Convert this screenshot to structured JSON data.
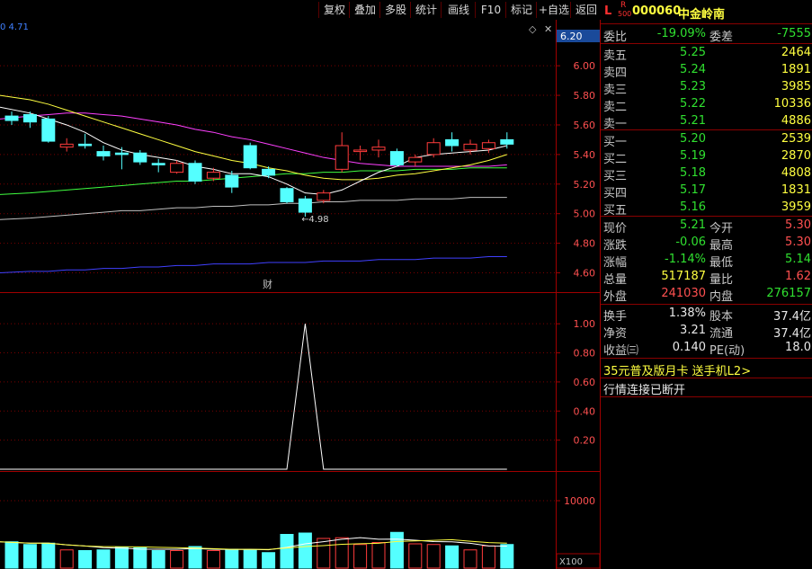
{
  "toolbar": {
    "buttons": [
      "复权",
      "叠加",
      "多股",
      "统计",
      "画线",
      "F10",
      "标记",
      "+自选",
      "返回"
    ]
  },
  "chart": {
    "ma_label": "0 4.71",
    "top_price_tag": "6.20",
    "price_axis": [
      "6.00",
      "5.80",
      "5.60",
      "5.40",
      "5.20",
      "5.00",
      "4.80",
      "4.60"
    ],
    "low_marker": "4.98",
    "fin_mark": "财",
    "indicator_axis": [
      "1.00",
      "0.80",
      "0.60",
      "0.40",
      "0.20"
    ],
    "volume_axis": [
      "10000"
    ],
    "volume_unit": "X100",
    "colors": {
      "up": "#ff3b3b",
      "down": "#54ffff",
      "ma5": "#ffffff",
      "ma10": "#ffff40",
      "ma20": "#ff40ff",
      "ma60": "#40ff40",
      "ma120": "#c0c0c0",
      "ma250": "#4040ff",
      "border": "#a00000"
    }
  },
  "chart_data": {
    "type": "candlestick",
    "candles": [
      {
        "o": 5.66,
        "h": 5.69,
        "l": 5.6,
        "c": 5.63
      },
      {
        "o": 5.67,
        "h": 5.69,
        "l": 5.58,
        "c": 5.62
      },
      {
        "o": 5.64,
        "h": 5.66,
        "l": 5.48,
        "c": 5.49
      },
      {
        "o": 5.45,
        "h": 5.51,
        "l": 5.42,
        "c": 5.47
      },
      {
        "o": 5.47,
        "h": 5.54,
        "l": 5.44,
        "c": 5.46
      },
      {
        "o": 5.42,
        "h": 5.46,
        "l": 5.36,
        "c": 5.39
      },
      {
        "o": 5.41,
        "h": 5.45,
        "l": 5.3,
        "c": 5.4
      },
      {
        "o": 5.41,
        "h": 5.43,
        "l": 5.33,
        "c": 5.35
      },
      {
        "o": 5.34,
        "h": 5.37,
        "l": 5.28,
        "c": 5.33
      },
      {
        "o": 5.28,
        "h": 5.36,
        "l": 5.27,
        "c": 5.34
      },
      {
        "o": 5.34,
        "h": 5.36,
        "l": 5.2,
        "c": 5.22
      },
      {
        "o": 5.24,
        "h": 5.31,
        "l": 5.22,
        "c": 5.28
      },
      {
        "o": 5.26,
        "h": 5.29,
        "l": 5.14,
        "c": 5.18
      },
      {
        "o": 5.46,
        "h": 5.48,
        "l": 5.3,
        "c": 5.31
      },
      {
        "o": 5.3,
        "h": 5.32,
        "l": 5.24,
        "c": 5.26
      },
      {
        "o": 5.17,
        "h": 5.18,
        "l": 5.07,
        "c": 5.08
      },
      {
        "o": 5.1,
        "h": 5.12,
        "l": 4.98,
        "c": 5.01
      },
      {
        "o": 5.09,
        "h": 5.16,
        "l": 5.07,
        "c": 5.14
      },
      {
        "o": 5.3,
        "h": 5.55,
        "l": 5.28,
        "c": 5.46
      },
      {
        "o": 5.42,
        "h": 5.46,
        "l": 5.36,
        "c": 5.43
      },
      {
        "o": 5.43,
        "h": 5.5,
        "l": 5.38,
        "c": 5.45
      },
      {
        "o": 5.42,
        "h": 5.44,
        "l": 5.32,
        "c": 5.33
      },
      {
        "o": 5.35,
        "h": 5.4,
        "l": 5.32,
        "c": 5.38
      },
      {
        "o": 5.4,
        "h": 5.51,
        "l": 5.38,
        "c": 5.48
      },
      {
        "o": 5.5,
        "h": 5.55,
        "l": 5.42,
        "c": 5.46
      },
      {
        "o": 5.43,
        "h": 5.5,
        "l": 5.4,
        "c": 5.47
      },
      {
        "o": 5.44,
        "h": 5.5,
        "l": 5.41,
        "c": 5.48
      },
      {
        "o": 5.5,
        "h": 5.55,
        "l": 5.44,
        "c": 5.47
      }
    ],
    "ma5": [
      5.72,
      5.68,
      5.64,
      5.6,
      5.55,
      5.48,
      5.43,
      5.4,
      5.38,
      5.36,
      5.32,
      5.3,
      5.27,
      5.27,
      5.25,
      5.2,
      5.14,
      5.13,
      5.16,
      5.22,
      5.28,
      5.32,
      5.38,
      5.4,
      5.41,
      5.42,
      5.43,
      5.46
    ],
    "ma10": [
      5.8,
      5.77,
      5.74,
      5.7,
      5.66,
      5.62,
      5.58,
      5.54,
      5.5,
      5.46,
      5.42,
      5.39,
      5.36,
      5.34,
      5.31,
      5.29,
      5.26,
      5.24,
      5.23,
      5.23,
      5.24,
      5.26,
      5.27,
      5.29,
      5.31,
      5.33,
      5.36,
      5.4
    ],
    "ma20": [
      5.64,
      5.66,
      5.67,
      5.68,
      5.68,
      5.67,
      5.66,
      5.64,
      5.62,
      5.6,
      5.57,
      5.55,
      5.52,
      5.5,
      5.47,
      5.44,
      5.41,
      5.38,
      5.36,
      5.34,
      5.33,
      5.32,
      5.32,
      5.32,
      5.32,
      5.32,
      5.32,
      5.33
    ],
    "ma60": [
      5.13,
      5.14,
      5.15,
      5.16,
      5.17,
      5.18,
      5.19,
      5.2,
      5.21,
      5.22,
      5.22,
      5.23,
      5.24,
      5.25,
      5.26,
      5.27,
      5.27,
      5.28,
      5.28,
      5.29,
      5.29,
      5.29,
      5.3,
      5.3,
      5.3,
      5.31,
      5.31,
      5.31
    ],
    "ma120": [
      4.96,
      4.97,
      4.98,
      4.99,
      5.0,
      5.01,
      5.02,
      5.02,
      5.03,
      5.04,
      5.04,
      5.05,
      5.05,
      5.06,
      5.06,
      5.07,
      5.07,
      5.08,
      5.08,
      5.09,
      5.09,
      5.09,
      5.1,
      5.1,
      5.1,
      5.11,
      5.11,
      5.11
    ],
    "ma250": [
      4.6,
      4.61,
      4.61,
      4.62,
      4.62,
      4.63,
      4.63,
      4.64,
      4.64,
      4.65,
      4.65,
      4.66,
      4.66,
      4.66,
      4.67,
      4.67,
      4.67,
      4.68,
      4.68,
      4.68,
      4.69,
      4.69,
      4.69,
      4.7,
      4.7,
      4.7,
      4.71,
      4.71
    ],
    "price_range": [
      4.5,
      6.25
    ],
    "indicator_range": [
      0,
      1.1
    ],
    "indicator": [
      0,
      0,
      0,
      0,
      0,
      0,
      0,
      0,
      0,
      0,
      0,
      0,
      0,
      0,
      0,
      0,
      1,
      0,
      0,
      0,
      0,
      0,
      0,
      0,
      0,
      0,
      0,
      0
    ],
    "volume_range": [
      0,
      14000
    ],
    "volume": [
      3900,
      3500,
      3700,
      2700,
      2600,
      2700,
      3100,
      3000,
      2600,
      2600,
      3200,
      2600,
      2800,
      2700,
      2300,
      5000,
      5200,
      4400,
      4500,
      3500,
      3800,
      5300,
      3600,
      3500,
      3300,
      2700,
      3300,
      3500,
      2900,
      2600,
      2600,
      2700,
      2500,
      2300
    ]
  },
  "quote": {
    "code_prefix": "L",
    "r_mark": "R",
    "r_sub": "500",
    "stock_code": "000060",
    "stock_name": "中金岭南",
    "weibi_label": "委比",
    "weibi_value": "-19.09%",
    "weicha_label": "委差",
    "weicha_value": "-7555",
    "sell": [
      {
        "label": "卖五",
        "price": "5.25",
        "vol": "2464"
      },
      {
        "label": "卖四",
        "price": "5.24",
        "vol": "1891"
      },
      {
        "label": "卖三",
        "price": "5.23",
        "vol": "3985"
      },
      {
        "label": "卖二",
        "price": "5.22",
        "vol": "10336"
      },
      {
        "label": "卖一",
        "price": "5.21",
        "vol": "4886"
      }
    ],
    "buy": [
      {
        "label": "买一",
        "price": "5.20",
        "vol": "2539"
      },
      {
        "label": "买二",
        "price": "5.19",
        "vol": "2870"
      },
      {
        "label": "买三",
        "price": "5.18",
        "vol": "4808"
      },
      {
        "label": "买四",
        "price": "5.17",
        "vol": "1831"
      },
      {
        "label": "买五",
        "price": "5.16",
        "vol": "3959"
      }
    ],
    "stats": [
      {
        "l1": "现价",
        "v1": "5.21",
        "c1": "green",
        "l2": "今开",
        "v2": "5.30",
        "c2": "red"
      },
      {
        "l1": "涨跌",
        "v1": "-0.06",
        "c1": "green",
        "l2": "最高",
        "v2": "5.30",
        "c2": "red"
      },
      {
        "l1": "涨幅",
        "v1": "-1.14%",
        "c1": "green",
        "l2": "最低",
        "v2": "5.14",
        "c2": "green"
      },
      {
        "l1": "总量",
        "v1": "517187",
        "c1": "yel",
        "l2": "量比",
        "v2": "1.62",
        "c2": "red"
      },
      {
        "l1": "外盘",
        "v1": "241030",
        "c1": "red",
        "l2": "内盘",
        "v2": "276157",
        "c2": "green"
      }
    ],
    "stats2": [
      {
        "l1": "换手",
        "v1": "1.38%",
        "l2": "股本",
        "v2": "37.4亿"
      },
      {
        "l1": "净资",
        "v1": "3.21",
        "l2": "流通",
        "v2": "37.4亿"
      },
      {
        "l1": "收益㈢",
        "v1": "0.140",
        "l2": "PE(动)",
        "v2": "18.0"
      }
    ],
    "promo": "35元普及版月卡 送手机L2>",
    "status": "行情连接已断开"
  }
}
